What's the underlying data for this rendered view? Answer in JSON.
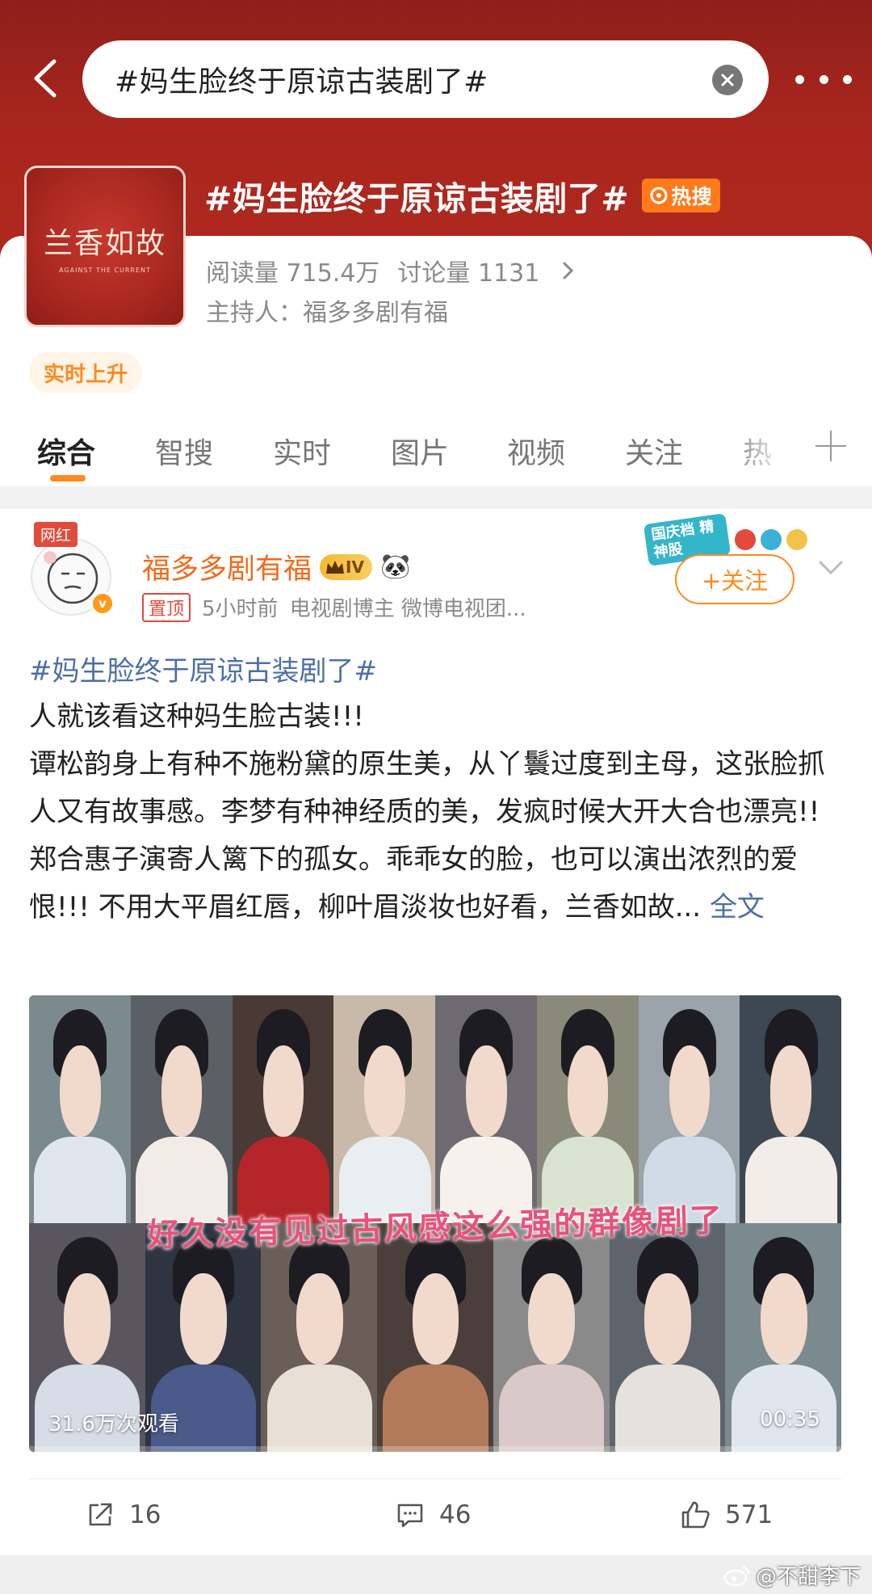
{
  "search": {
    "query": "#妈生脸终于原谅古装剧了#"
  },
  "topic": {
    "title": "#妈生脸终于原谅古装剧了#",
    "hot_label": "热搜",
    "poster_title": "兰香如故",
    "poster_subtitle": "AGAINST THE CURRENT",
    "reads": "阅读量 715.4万",
    "discussions": "讨论量 1131",
    "host": "主持人：福多多剧有福",
    "rising_tag": "实时上升"
  },
  "tabs": [
    {
      "label": "综合"
    },
    {
      "label": "智搜"
    },
    {
      "label": "实时"
    },
    {
      "label": "图片"
    },
    {
      "label": "视频"
    },
    {
      "label": "关注"
    },
    {
      "label": "热"
    }
  ],
  "post": {
    "avatar_tag": "网红",
    "username": "福多多剧有福",
    "vip_level": "IV",
    "pin_label": "置顶",
    "time": "5小时前",
    "description": "电视剧博主 微博电视团...",
    "event_badge": "国庆档 精神股",
    "follow_label": "+关注",
    "hashtag": "#妈生脸终于原谅古装剧了#",
    "body": "人就该看这种妈生脸古装!!!\n谭松韵身上有种不施粉黛的原生美，从丫鬟过度到主母，这张脸抓人又有故事感。李梦有种神经质的美，发疯时候大开大合也漂亮!! 郑合惠子演寄人篱下的孤女。乖乖女的脸，也可以演出浓烈的爱恨!!! 不用大平眉红唇，柳叶眉淡妆也好看，兰香如故...",
    "read_more": "全文",
    "video": {
      "caption": "好久没有见过古风感这么强的群像剧了",
      "views": "31.6万次观看",
      "duration": "00:35"
    },
    "actions": {
      "reposts": "16",
      "comments": "46",
      "likes": "571"
    }
  },
  "watermark": "@不甜李下",
  "colors": {
    "header_red": "#a8261e",
    "accent_orange": "#ff8a1f",
    "link_blue": "#4d6fa9",
    "username_orange": "#f26a1b"
  }
}
